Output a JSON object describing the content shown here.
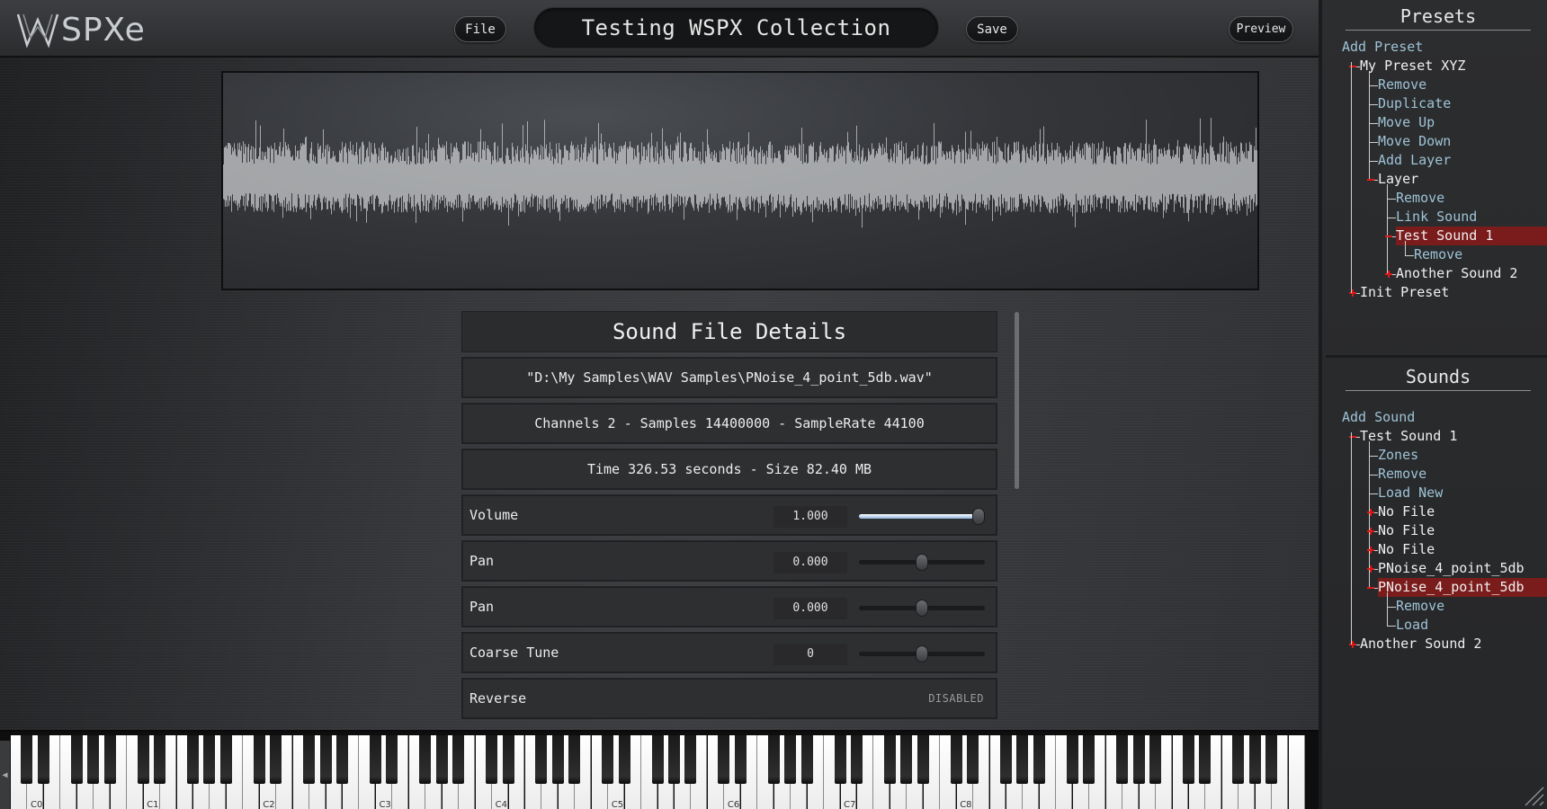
{
  "app": {
    "logo_text": "SPXe",
    "collection_title": "Testing WSPX Collection"
  },
  "toolbar": {
    "file_label": "File",
    "save_label": "Save",
    "preview_label": "Preview"
  },
  "details": {
    "title": "Sound File Details",
    "path": "\"D:\\My Samples\\WAV Samples\\PNoise_4_point_5db.wav\"",
    "format": "Channels 2 - Samples 14400000 - SampleRate 44100",
    "time_size": "Time 326.53 seconds - Size 82.40 MB",
    "params": [
      {
        "label": "Volume",
        "value": "1.000",
        "level": 1.0,
        "filled": true
      },
      {
        "label": "Pan",
        "value": "0.000",
        "level": 0.5,
        "filled": false
      },
      {
        "label": "Pan",
        "value": "0.000",
        "level": 0.5,
        "filled": false
      },
      {
        "label": "Coarse Tune",
        "value": "0",
        "level": 0.5,
        "filled": false
      }
    ],
    "reverse": {
      "label": "Reverse",
      "status": "DISABLED"
    }
  },
  "keyboard": {
    "octave_labels": [
      "C0",
      "C1",
      "C2",
      "C3",
      "C4",
      "C5",
      "C6",
      "C7",
      "C8"
    ]
  },
  "presets": {
    "title": "Presets",
    "tree": [
      {
        "text": "Add Preset",
        "depth": 0,
        "kind": "link"
      },
      {
        "text": "My Preset XYZ",
        "depth": 1,
        "kind": "node",
        "expanded": true
      },
      {
        "text": "Remove",
        "depth": 2,
        "kind": "link"
      },
      {
        "text": "Duplicate",
        "depth": 2,
        "kind": "link"
      },
      {
        "text": "Move Up",
        "depth": 2,
        "kind": "link"
      },
      {
        "text": "Move Down",
        "depth": 2,
        "kind": "link"
      },
      {
        "text": "Add Layer",
        "depth": 2,
        "kind": "link"
      },
      {
        "text": "Layer",
        "depth": 2,
        "kind": "node",
        "expanded": true
      },
      {
        "text": "Remove",
        "depth": 3,
        "kind": "link"
      },
      {
        "text": "Link Sound",
        "depth": 3,
        "kind": "link"
      },
      {
        "text": "Test Sound 1",
        "depth": 3,
        "kind": "node",
        "expanded": true,
        "selected": true
      },
      {
        "text": "Remove",
        "depth": 4,
        "kind": "link"
      },
      {
        "text": "Another Sound 2",
        "depth": 3,
        "kind": "node",
        "expanded": false
      },
      {
        "text": "Init Preset",
        "depth": 1,
        "kind": "node",
        "expanded": false
      }
    ]
  },
  "sounds": {
    "title": "Sounds",
    "tree": [
      {
        "text": "Add Sound",
        "depth": 0,
        "kind": "link"
      },
      {
        "text": "Test Sound 1",
        "depth": 1,
        "kind": "node",
        "expanded": true
      },
      {
        "text": "Zones",
        "depth": 2,
        "kind": "link"
      },
      {
        "text": "Remove",
        "depth": 2,
        "kind": "link"
      },
      {
        "text": "Load New",
        "depth": 2,
        "kind": "link"
      },
      {
        "text": "No File",
        "depth": 2,
        "kind": "node",
        "expanded": false
      },
      {
        "text": "No File",
        "depth": 2,
        "kind": "node",
        "expanded": false
      },
      {
        "text": "No File",
        "depth": 2,
        "kind": "node",
        "expanded": false
      },
      {
        "text": "PNoise_4_point_5db",
        "depth": 2,
        "kind": "node",
        "expanded": false
      },
      {
        "text": "PNoise_4_point_5db",
        "depth": 2,
        "kind": "node",
        "expanded": true,
        "selected": true
      },
      {
        "text": "Remove",
        "depth": 3,
        "kind": "link"
      },
      {
        "text": "Load",
        "depth": 3,
        "kind": "link"
      },
      {
        "text": "Another Sound 2",
        "depth": 1,
        "kind": "node",
        "expanded": false
      }
    ]
  },
  "colors": {
    "accent_red": "#e01818",
    "selection": "#7b1c1c",
    "link": "#9ec3d6"
  }
}
